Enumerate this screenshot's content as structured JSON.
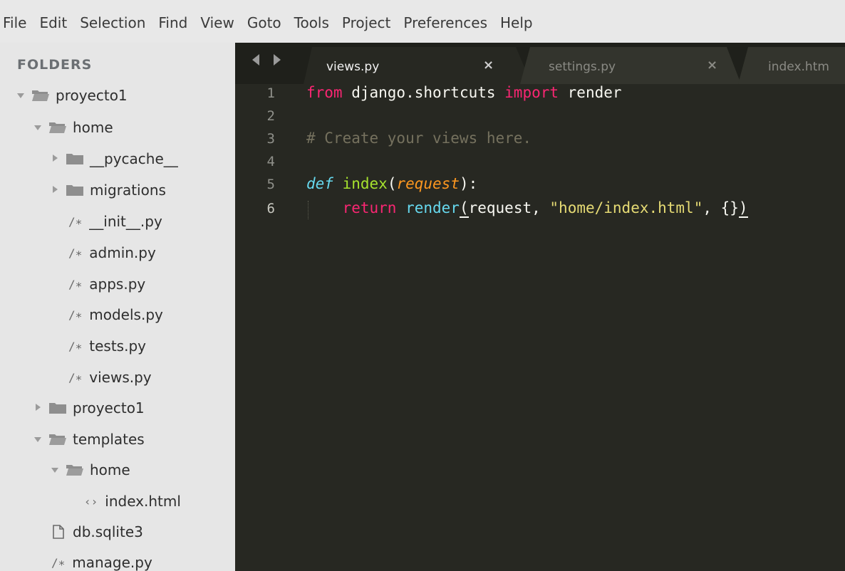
{
  "menubar": {
    "items": [
      "File",
      "Edit",
      "Selection",
      "Find",
      "View",
      "Goto",
      "Tools",
      "Project",
      "Preferences",
      "Help"
    ]
  },
  "sidebar": {
    "header": "FOLDERS",
    "tree": [
      {
        "label": "proyecto1",
        "kind": "folder",
        "state": "open"
      },
      {
        "label": "home",
        "kind": "folder",
        "state": "open"
      },
      {
        "label": "__pycache__",
        "kind": "folder",
        "state": "closed"
      },
      {
        "label": "migrations",
        "kind": "folder",
        "state": "closed"
      },
      {
        "label": "__init__.py",
        "kind": "file",
        "icon": "/∗"
      },
      {
        "label": "admin.py",
        "kind": "file",
        "icon": "/∗"
      },
      {
        "label": "apps.py",
        "kind": "file",
        "icon": "/∗"
      },
      {
        "label": "models.py",
        "kind": "file",
        "icon": "/∗"
      },
      {
        "label": "tests.py",
        "kind": "file",
        "icon": "/∗"
      },
      {
        "label": "views.py",
        "kind": "file",
        "icon": "/∗"
      },
      {
        "label": "proyecto1",
        "kind": "folder",
        "state": "closed"
      },
      {
        "label": "templates",
        "kind": "folder",
        "state": "open"
      },
      {
        "label": "home",
        "kind": "folder",
        "state": "open"
      },
      {
        "label": "index.html",
        "kind": "file",
        "icon": "‹›"
      },
      {
        "label": "db.sqlite3",
        "kind": "file",
        "icon": "page"
      },
      {
        "label": "manage.py",
        "kind": "file",
        "icon": "/∗"
      }
    ]
  },
  "tabs": [
    {
      "title": "views.py",
      "close": "×",
      "active": true
    },
    {
      "title": "settings.py",
      "close": "×",
      "active": false
    },
    {
      "title": "index.htm",
      "close": "",
      "active": false
    }
  ],
  "editor": {
    "line_numbers": [
      "1",
      "2",
      "3",
      "4",
      "5",
      "6"
    ],
    "active_line": "6",
    "lines": {
      "l1": {
        "t0": "from",
        "t1": " django.shortcuts ",
        "t2": "import",
        "t3": " render"
      },
      "l3": {
        "t0": "# Create your views here."
      },
      "l5": {
        "t0": "def",
        "t1": " ",
        "t2": "index",
        "t3": "(",
        "t4": "request",
        "t5": "):"
      },
      "l6": {
        "t0": "    ",
        "t1": "return",
        "t2": " ",
        "t3": "render",
        "t4": "(",
        "t5": "request, ",
        "t6": "\"home/index.html\"",
        "t7": ", {}",
        "t8": ")"
      }
    }
  },
  "colors": {
    "editor_bg": "#272822",
    "sidebar_bg": "#e6e6e6",
    "keyword": "#f92672",
    "function": "#a6e22e",
    "string": "#e6db74",
    "comment": "#75715e",
    "builtin": "#66d9ef",
    "parameter": "#fd971f"
  }
}
